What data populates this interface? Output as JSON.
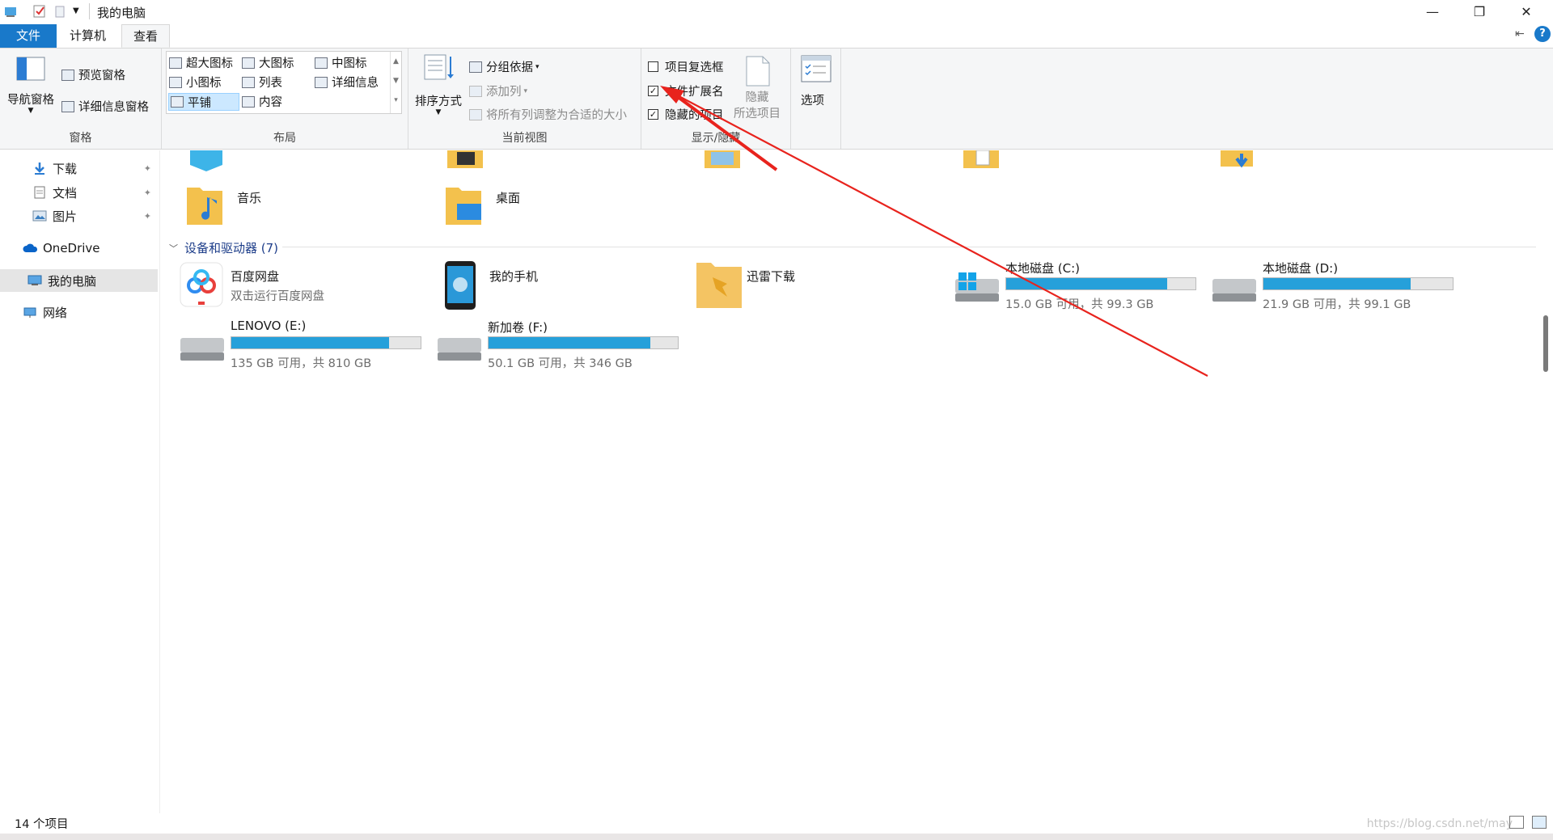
{
  "window": {
    "title": "我的电脑",
    "minimize_glyph": "—",
    "restore_glyph": "❐",
    "close_glyph": "✕"
  },
  "ribbon_tabs": [
    "文件",
    "计算机",
    "查看"
  ],
  "ribbon": {
    "panes_group": {
      "label": "窗格",
      "nav_pane": "导航窗格",
      "preview_pane": "预览窗格",
      "details_pane": "详细信息窗格"
    },
    "layout_group": {
      "label": "布局",
      "items": [
        "超大图标",
        "大图标",
        "中图标",
        "小图标",
        "列表",
        "详细信息",
        "平铺",
        "内容"
      ],
      "selected": "平铺"
    },
    "current_view_group": {
      "label": "当前视图",
      "sort_by": "排序方式",
      "group_by": "分组依据",
      "add_column": "添加列",
      "size_all_columns": "将所有列调整为合适的大小"
    },
    "show_hide_group": {
      "label": "显示/隐藏",
      "item_checkboxes": {
        "label": "项目复选框",
        "checked": false
      },
      "file_extensions": {
        "label": "文件扩展名",
        "checked": true
      },
      "hidden_items": {
        "label": "隐藏的项目",
        "checked": true
      },
      "hide_selected": "隐藏\n所选项目",
      "hide_selected_l1": "隐藏",
      "hide_selected_l2": "所选项目"
    },
    "options_group": {
      "options": "选项"
    },
    "help_glyph": "?"
  },
  "nav": {
    "items": [
      {
        "label": "下载",
        "icon": "download-icon",
        "pinned": true
      },
      {
        "label": "文档",
        "icon": "document-icon",
        "pinned": true
      },
      {
        "label": "图片",
        "icon": "pictures-icon",
        "pinned": true
      },
      {
        "label": "OneDrive",
        "icon": "cloud-icon"
      },
      {
        "label": "我的电脑",
        "icon": "computer-icon",
        "selected": true
      },
      {
        "label": "网络",
        "icon": "network-icon"
      }
    ],
    "pin_glyph": "📌"
  },
  "folders": [
    {
      "name": "音乐",
      "icon": "music-folder-icon"
    },
    {
      "name": "桌面",
      "icon": "desktop-folder-icon"
    }
  ],
  "devices": {
    "header": "设备和驱动器 (7)",
    "items": [
      {
        "name": "百度网盘",
        "sub": "双击运行百度网盘",
        "icon": "baidu-netdisk-icon"
      },
      {
        "name": "我的手机",
        "icon": "phone-icon"
      },
      {
        "name": "迅雷下载",
        "icon": "xunlei-folder-icon"
      },
      {
        "name": "本地磁盘 (C:)",
        "free": "15.0 GB 可用，共 99.3 GB",
        "used_fraction": 0.849,
        "icon": "windows-drive-icon"
      },
      {
        "name": "本地磁盘 (D:)",
        "free": "21.9 GB 可用，共 99.1 GB",
        "used_fraction": 0.779,
        "icon": "drive-icon"
      },
      {
        "name": "LENOVO (E:)",
        "free": "135 GB 可用，共 810 GB",
        "used_fraction": 0.833,
        "icon": "drive-icon"
      },
      {
        "name": "新加卷 (F:)",
        "free": "50.1 GB 可用，共 346 GB",
        "used_fraction": 0.855,
        "icon": "drive-icon"
      }
    ]
  },
  "status": {
    "count": "14 个项目",
    "watermark": "https://blog.csdn.net/may"
  },
  "colors": {
    "file_tab": "#1979ca",
    "progress": "#26a0da",
    "annotation": "#e8231d"
  }
}
